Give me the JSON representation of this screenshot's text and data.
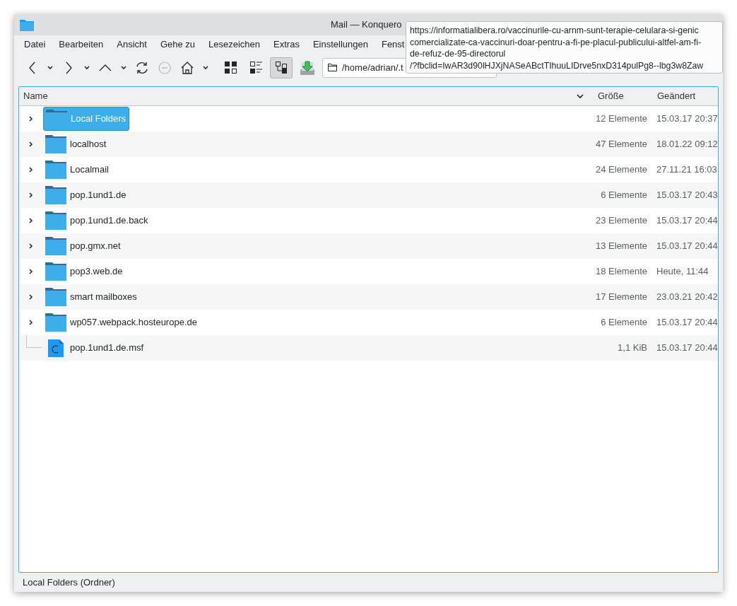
{
  "window": {
    "title": "Mail — Konquero"
  },
  "menu": [
    "Datei",
    "Bearbeiten",
    "Ansicht",
    "Gehe zu",
    "Lesezeichen",
    "Extras",
    "Einstellungen",
    "Fenst"
  ],
  "toolbar": [
    {
      "kind": "back",
      "disabled": false
    },
    {
      "kind": "dropdown",
      "disabled": false
    },
    {
      "kind": "forward",
      "disabled": false
    },
    {
      "kind": "dropdown",
      "disabled": false
    },
    {
      "kind": "up",
      "disabled": false
    },
    {
      "kind": "dropdown",
      "disabled": false
    },
    {
      "kind": "reload",
      "disabled": false
    },
    {
      "kind": "stop",
      "disabled": true
    },
    {
      "kind": "home",
      "disabled": false
    },
    {
      "kind": "dropdown",
      "disabled": false
    }
  ],
  "views": [
    {
      "kind": "icons",
      "selected": false
    },
    {
      "kind": "details",
      "selected": false
    },
    {
      "kind": "tree",
      "selected": true
    }
  ],
  "address": {
    "value": "/home/adrian/.t"
  },
  "tooltip": [
    "https://informatialibera.ro/vaccinurile-cu-arnm-sunt-terapie-celulara-si-genic",
    "comercializate-ca-vaccinuri-doar-pentru-a-fi-pe-placul-publicului-altfel-am-fi-",
    "de-refuz-de-95-directorul",
    "/?fbclid=IwAR3d90lHJXjNASeABctTIhuuLIDrve5nxD314pulPg8--lbg3w8Zaw"
  ],
  "table": {
    "columns": [
      "Name",
      "Größe",
      "Geändert"
    ],
    "rows": [
      {
        "kind": "folder",
        "name": "Local Folders",
        "size": "12 Elemente",
        "modified": "15.03.17 20:37",
        "selected": true
      },
      {
        "kind": "folder",
        "name": "localhost",
        "size": "47 Elemente",
        "modified": "18.01.22 09:12",
        "selected": false
      },
      {
        "kind": "folder",
        "name": "Localmail",
        "size": "24 Elemente",
        "modified": "27.11.21 16:03",
        "selected": false
      },
      {
        "kind": "folder",
        "name": "pop.1und1.de",
        "size": "6 Elemente",
        "modified": "15.03.17 20:43",
        "selected": false
      },
      {
        "kind": "folder",
        "name": "pop.1und1.de.back",
        "size": "23 Elemente",
        "modified": "15.03.17 20:44",
        "selected": false
      },
      {
        "kind": "folder",
        "name": "pop.gmx.net",
        "size": "13 Elemente",
        "modified": "15.03.17 20:44",
        "selected": false
      },
      {
        "kind": "folder",
        "name": "pop3.web.de",
        "size": "18 Elemente",
        "modified": "Heute, 11:44",
        "selected": false
      },
      {
        "kind": "folder",
        "name": "smart mailboxes",
        "size": "17 Elemente",
        "modified": "23.03.21 20:42",
        "selected": false
      },
      {
        "kind": "folder",
        "name": "wp057.webpack.hosteurope.de",
        "size": "6 Elemente",
        "modified": "15.03.17 20:44",
        "selected": false
      },
      {
        "kind": "file",
        "name": "pop.1und1.de.msf",
        "size": "1,1 KiB",
        "modified": "15.03.17 20:44",
        "selected": false
      }
    ]
  },
  "status_bar": "Local Folders (Ordner)"
}
